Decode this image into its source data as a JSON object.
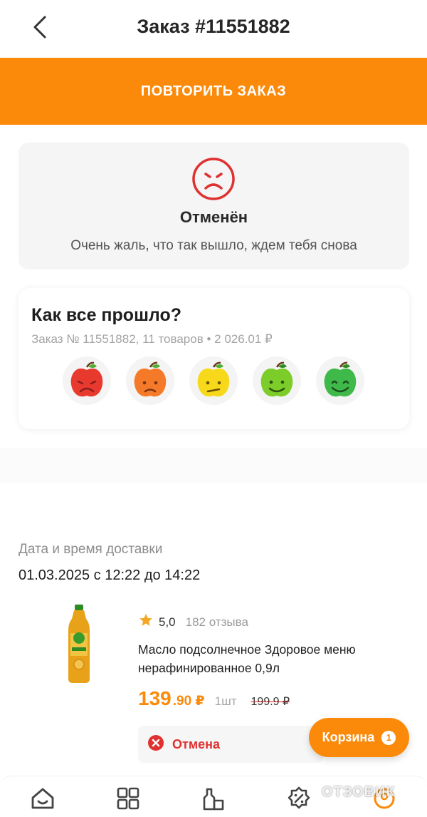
{
  "header": {
    "title": "Заказ #11551882"
  },
  "actions": {
    "repeat_label": "ПОВТОРИТЬ ЗАКАЗ"
  },
  "status": {
    "title": "Отменён",
    "subtitle": "Очень жаль, что так вышло, ждем тебя снова",
    "accent_color": "#e03131"
  },
  "rating": {
    "title": "Как все прошло?",
    "subtitle": "Заказ № 11551882, 11 товаров • 2 026.01 ₽",
    "options": [
      {
        "icon": "red-sad-apple-icon",
        "color": "#e8392e"
      },
      {
        "icon": "orange-upset-apple-icon",
        "color": "#f47a2a"
      },
      {
        "icon": "yellow-neutral-apple-icon",
        "color": "#f7d81a"
      },
      {
        "icon": "lime-smile-apple-icon",
        "color": "#7ccc2a"
      },
      {
        "icon": "green-happy-apple-icon",
        "color": "#3fb94a"
      }
    ]
  },
  "delivery": {
    "label": "Дата и время доставки",
    "value": "01.03.2025 с 12:22 до 14:22"
  },
  "product": {
    "rating": "5,0",
    "reviews": "182 отзыва",
    "name": "Масло подсолнечное Здоровое меню нерафинированное 0,9л",
    "price_int": "139",
    "price_frac": ".90 ₽",
    "quantity": "1шт",
    "old_price": "199.9 ₽",
    "status": "Отмена"
  },
  "cart": {
    "label": "Корзина",
    "count": "1"
  },
  "tabbar": {
    "items": [
      {
        "icon": "home-icon"
      },
      {
        "icon": "catalog-icon"
      },
      {
        "icon": "shops-icon"
      },
      {
        "icon": "promo-icon"
      },
      {
        "icon": "profile-icon"
      }
    ]
  },
  "watermark": "ОТЗОВИК",
  "brand_color": "#fb8a0a"
}
